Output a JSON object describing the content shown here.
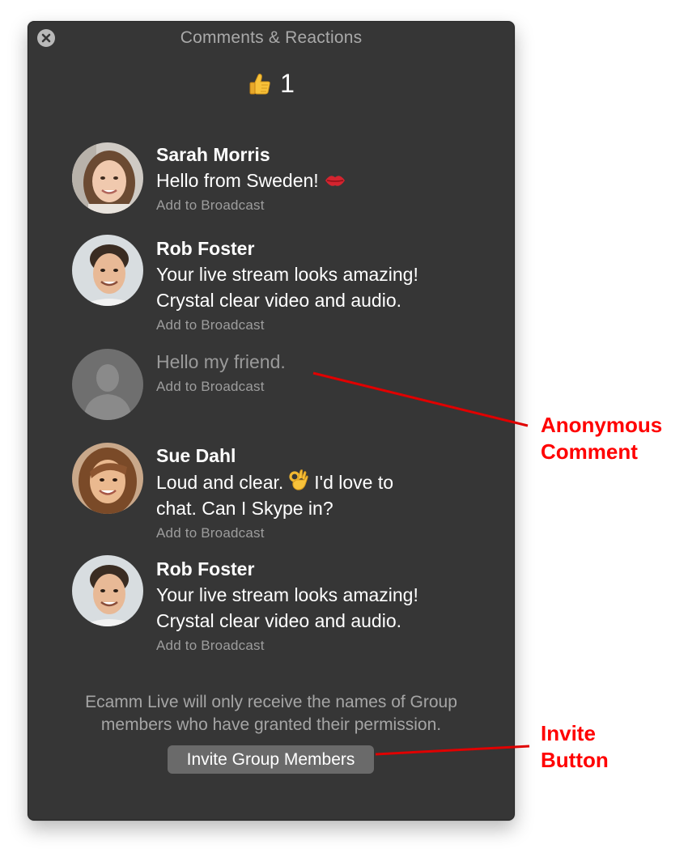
{
  "window": {
    "title": "Comments & Reactions"
  },
  "reactions": {
    "icon": "thumbs-up-icon",
    "count": "1"
  },
  "comments": [
    {
      "author": "Sarah Morris",
      "text": "Hello from Sweden!",
      "emoji": "kiss-lips-icon",
      "action": "Add to Broadcast"
    },
    {
      "author": "Rob Foster",
      "text": "Your live stream looks amazing!\nCrystal clear video and audio.",
      "action": "Add to Broadcast"
    },
    {
      "author": "",
      "text": "Hello my friend.",
      "action": "Add to Broadcast"
    },
    {
      "author": "Sue Dahl",
      "text_before": "Loud and clear.",
      "emoji": "ok-hand-icon",
      "text_after": "I'd love to\nchat. Can I Skype in?",
      "action": "Add to Broadcast"
    },
    {
      "author": "Rob Foster",
      "text": "Your live stream looks amazing!\nCrystal clear video and audio.",
      "action": "Add to Broadcast"
    }
  ],
  "footer": {
    "notice": "Ecamm Live will only receive the names of Group\nmembers who have granted their permission.",
    "invite_button": "Invite Group Members"
  },
  "annotations": {
    "anonymous": "Anonymous\nComment",
    "invite": "Invite\nButton"
  },
  "colors": {
    "panel_bg": "#363636",
    "annotation": "#ff0000",
    "button_bg": "#6a6a6a"
  }
}
